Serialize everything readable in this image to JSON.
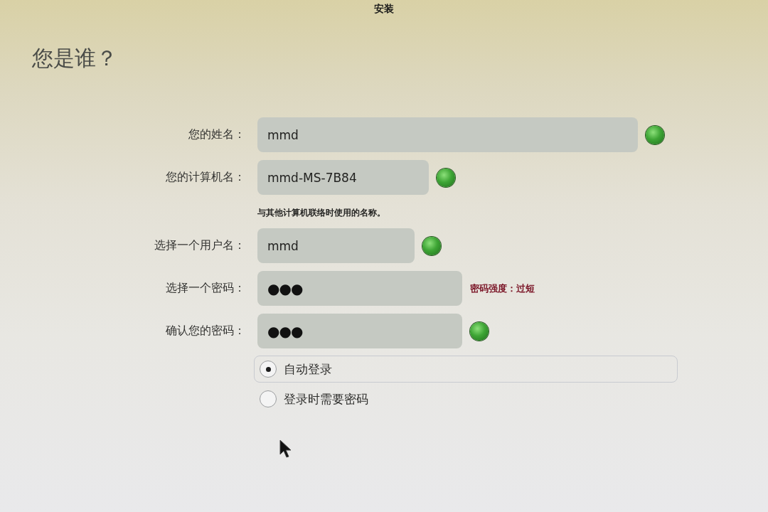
{
  "window": {
    "title": "安装"
  },
  "heading": "您是谁？",
  "fields": [
    {
      "kind": "text",
      "label": "您的姓名：",
      "value": "mmd",
      "valid": true
    },
    {
      "kind": "text",
      "label": "您的计算机名：",
      "value": "mmd-MS-7B84",
      "valid": true,
      "hint": "与其他计算机联络时使用的名称。"
    },
    {
      "kind": "text",
      "label": "选择一个用户名：",
      "value": "mmd",
      "valid": true
    },
    {
      "kind": "password",
      "label": "选择一个密码：",
      "value": "●●●",
      "valid": false,
      "strength": "密码强度：过短"
    },
    {
      "kind": "password",
      "label": "确认您的密码：",
      "value": "●●●",
      "valid": true
    }
  ],
  "login_options": [
    {
      "label": "自动登录",
      "selected": true,
      "focused": true
    },
    {
      "label": "登录时需要密码",
      "selected": false,
      "focused": false
    }
  ]
}
